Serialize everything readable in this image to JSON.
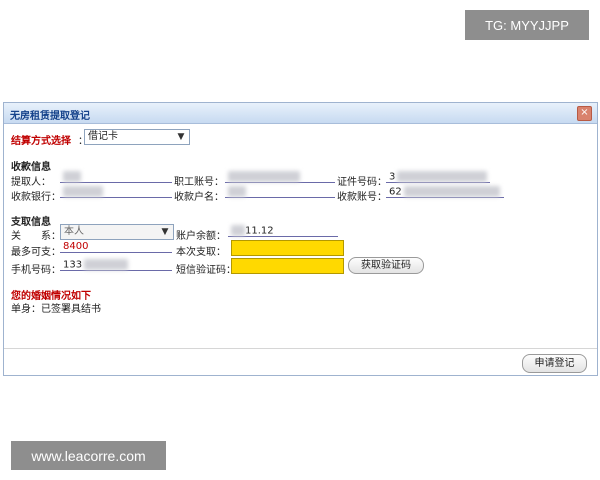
{
  "watermarks": {
    "top": "TG: MYYJJPP",
    "bottom": "www.leacorre.com"
  },
  "dialog": {
    "title": "无房租赁提取登记",
    "close_glyph": "×",
    "settlement": {
      "label": "结算方式选择",
      "colon": "：",
      "value": "借记卡"
    },
    "receive_section": {
      "heading": "收款信息",
      "extractor_label": "提取人：",
      "staff_account_label": "职工账号：",
      "id_number_label": "证件号码：",
      "id_number_partial": "3",
      "bank_label": "收款银行：",
      "bank_partial": "",
      "account_name_label": "收款户名：",
      "account_no_label": "收款账号：",
      "account_no_partial": "62"
    },
    "withdraw_section": {
      "heading": "支取信息",
      "relation_label": "关　　系：",
      "relation_value": "本人",
      "balance_label": "账户余额：",
      "balance_value": "11.12",
      "max_label": "最多可支：",
      "max_value": "8400",
      "this_time_label": "本次支取：",
      "phone_label": "手机号码：",
      "phone_partial": "133",
      "sms_label": "短信验证码：",
      "get_code_button": "获取验证码"
    },
    "marriage_section": {
      "heading": "您的婚姻情况如下",
      "status_text": "单身：已签署具结书"
    },
    "footer": {
      "submit_button": "申请登记"
    }
  }
}
